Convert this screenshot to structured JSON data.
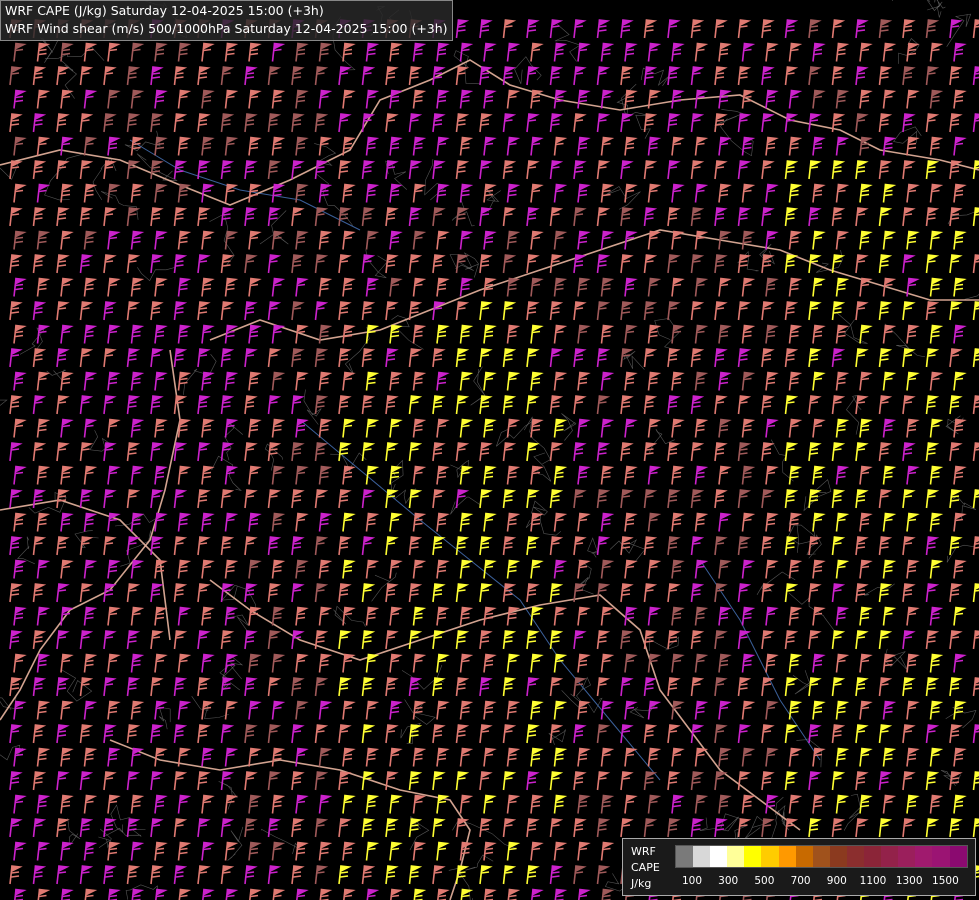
{
  "header": {
    "line1": "WRF CAPE (J/kg) Saturday 12-04-2025 15:00 (+3h)",
    "line2": "WRF Wind shear (m/s) 500/1000hPa Saturday 12-04-2025 15:00 (+3h)"
  },
  "legend": {
    "label_model": "WRF",
    "label_field": "CAPE",
    "label_unit": "J/kg",
    "swatches": [
      "#7a7a7a",
      "#d8d8d8",
      "#ffffff",
      "#ffff99",
      "#ffff00",
      "#ffcc00",
      "#ff9900",
      "#c86a00",
      "#a0521c",
      "#8b3a1f",
      "#8b2e2e",
      "#8b2538",
      "#93224a",
      "#9b1f5c",
      "#a01a6e",
      "#9b1473",
      "#8b0a70"
    ],
    "ticks": [
      "100",
      "300",
      "500",
      "700",
      "900",
      "1100",
      "1300",
      "1500"
    ]
  },
  "colors": {
    "background": "#000000",
    "barb_low": "#a05a5a",
    "barb_mid": "#e07a72",
    "barb_high": "#cc22cc",
    "barb_very_high": "#ffff33",
    "border": "#e9b5a0",
    "contour": "#9a9a9a",
    "river": "#4a78c0"
  },
  "icons": {
    "wind_barb": "wind-barb-icon"
  }
}
